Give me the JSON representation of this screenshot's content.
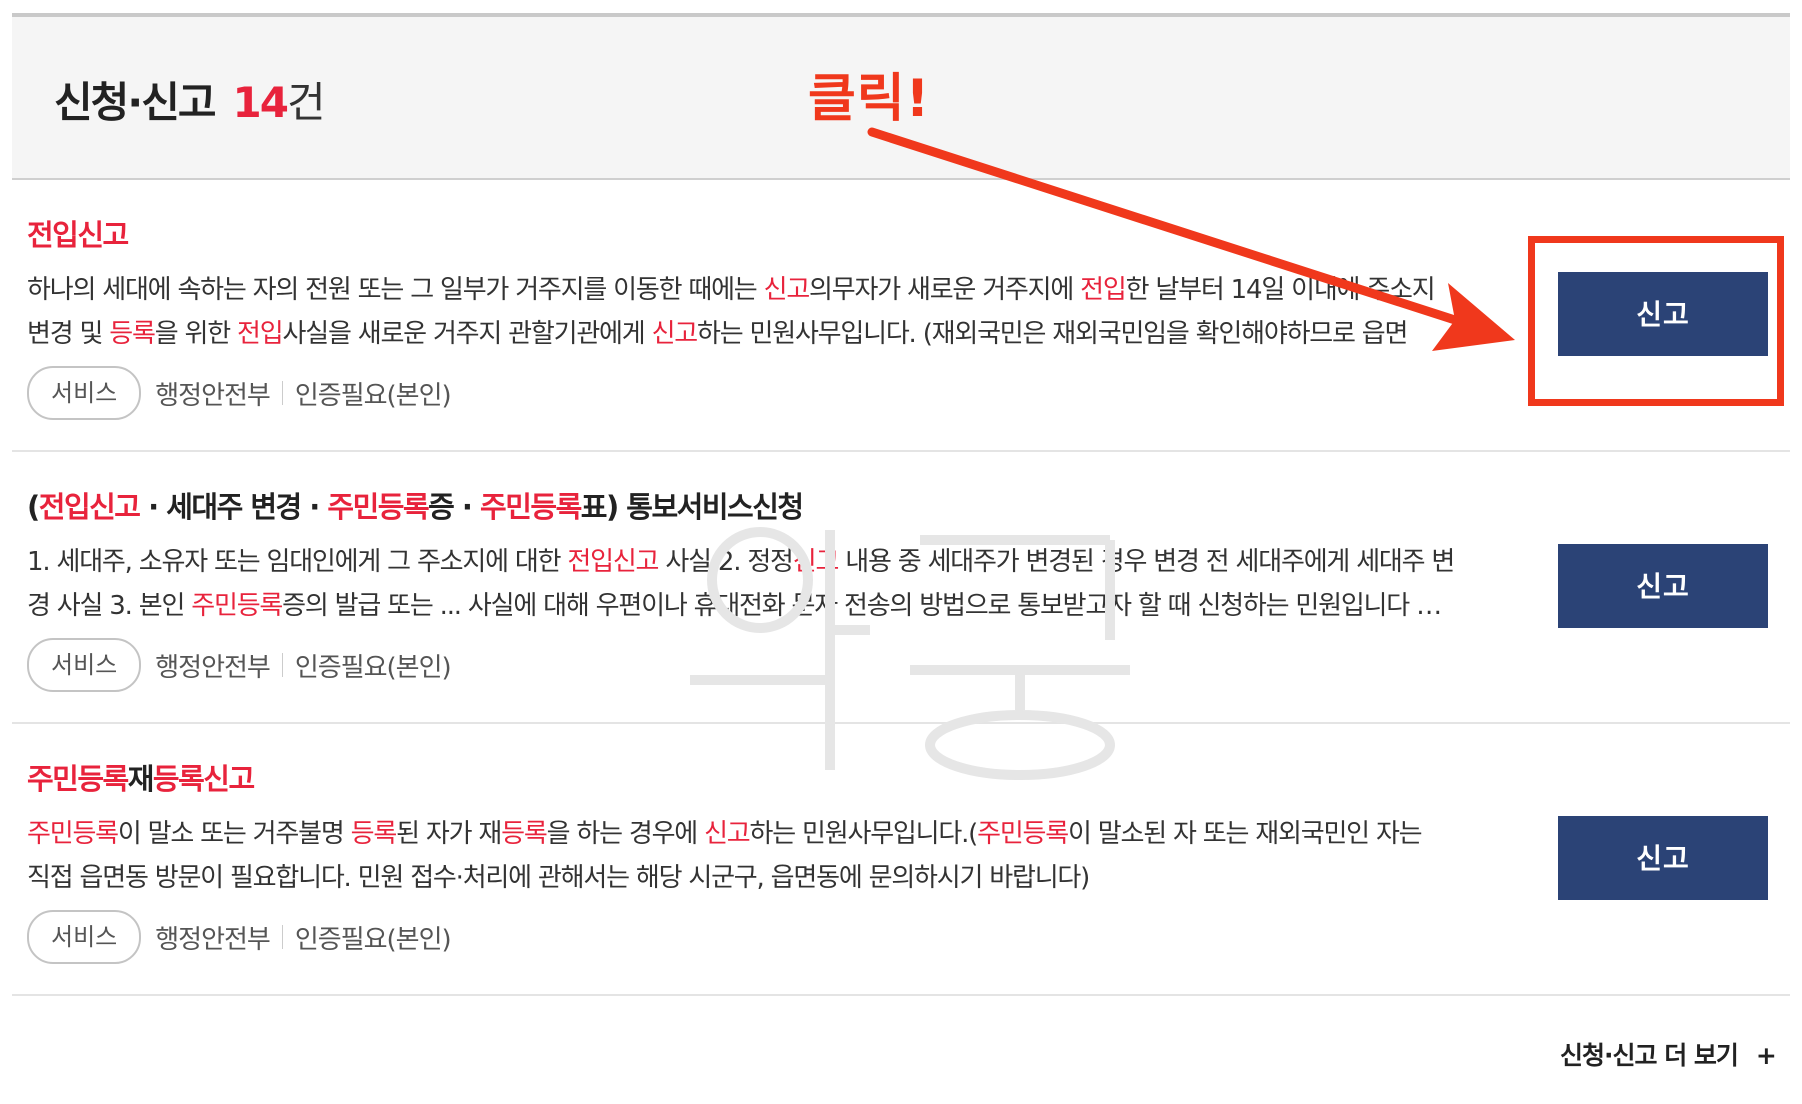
{
  "section": {
    "title": "신청·신고",
    "count": "14",
    "count_unit": "건"
  },
  "annotation": {
    "label": "클릭!",
    "color": "#f0381c"
  },
  "items": [
    {
      "title_parts": [
        {
          "text": "전입신고",
          "hl": true
        }
      ],
      "desc_lines": [
        [
          {
            "text": "하나의 세대에 속하는 자의 전원 또는 그 일부가 거주지를 이동한 때에는 ",
            "hl": false
          },
          {
            "text": "신고",
            "hl": true
          },
          {
            "text": "의무자가 새로운 거주지에 ",
            "hl": false
          },
          {
            "text": "전입",
            "hl": true
          },
          {
            "text": "한 날부터 14일 이내에 주소지",
            "hl": false
          }
        ],
        [
          {
            "text": "변경 및 ",
            "hl": false
          },
          {
            "text": "등록",
            "hl": true
          },
          {
            "text": "을 위한 ",
            "hl": false
          },
          {
            "text": "전입",
            "hl": true
          },
          {
            "text": "사실을 새로운 거주지 관할기관에게 ",
            "hl": false
          },
          {
            "text": "신고",
            "hl": true
          },
          {
            "text": "하는 민원사무입니다. (재외국민은 재외국민임을 확인해야하므로 읍면",
            "hl": false
          }
        ]
      ],
      "badge": "서비스",
      "agency": "행정안전부",
      "auth": "인증필요(본인)",
      "button": "신고"
    },
    {
      "title_parts": [
        {
          "text": "(",
          "hl": false
        },
        {
          "text": "전입신고",
          "hl": true
        },
        {
          "text": " · 세대주 변경 · ",
          "hl": false
        },
        {
          "text": "주민등록",
          "hl": true
        },
        {
          "text": "증 · ",
          "hl": false
        },
        {
          "text": "주민등록",
          "hl": true
        },
        {
          "text": "표) 통보서비스신청",
          "hl": false
        }
      ],
      "desc_lines": [
        [
          {
            "text": "1. 세대주, 소유자 또는 임대인에게 그 주소지에 대한 ",
            "hl": false
          },
          {
            "text": "전입신고",
            "hl": true
          },
          {
            "text": " 사실 2. 정정",
            "hl": false
          },
          {
            "text": "신고",
            "hl": true
          },
          {
            "text": " 내용 중 세대주가 변경된 경우 변경 전 세대주에게 세대주 변",
            "hl": false
          }
        ],
        [
          {
            "text": "경 사실 3. 본인 ",
            "hl": false
          },
          {
            "text": "주민등록",
            "hl": true
          },
          {
            "text": "증의 발급 또는 ... 사실에 대해 우편이나 휴대전화 문자 전송의 방법으로 통보받고자 할 때 신청하는 민원입니다 …",
            "hl": false
          }
        ]
      ],
      "badge": "서비스",
      "agency": "행정안전부",
      "auth": "인증필요(본인)",
      "button": "신고"
    },
    {
      "title_parts": [
        {
          "text": "주민등록",
          "hl": true
        },
        {
          "text": "재",
          "hl": false
        },
        {
          "text": "등록신고",
          "hl": true
        }
      ],
      "desc_lines": [
        [
          {
            "text": "주민등록",
            "hl": true
          },
          {
            "text": "이 말소 또는 거주불명 ",
            "hl": false
          },
          {
            "text": "등록",
            "hl": true
          },
          {
            "text": "된 자가 재",
            "hl": false
          },
          {
            "text": "등록",
            "hl": true
          },
          {
            "text": "을 하는 경우에 ",
            "hl": false
          },
          {
            "text": "신고",
            "hl": true
          },
          {
            "text": "하는 민원사무입니다.(",
            "hl": false
          },
          {
            "text": "주민등록",
            "hl": true
          },
          {
            "text": "이 말소된 자 또는 재외국민인 자는",
            "hl": false
          }
        ],
        [
          {
            "text": "직접 읍면동 방문이 필요합니다. 민원 접수·처리에 관해서는 해당 시군구, 읍면동에 문의하시기 바랍니다)",
            "hl": false
          }
        ]
      ],
      "badge": "서비스",
      "agency": "행정안전부",
      "auth": "인증필요(본인)",
      "button": "신고"
    }
  ],
  "more_link": {
    "label": "신청·신고 더 보기",
    "icon": "plus-icon"
  },
  "colors": {
    "highlight": "#e8233c",
    "button": "#2b4376",
    "annotation": "#f0381c"
  }
}
